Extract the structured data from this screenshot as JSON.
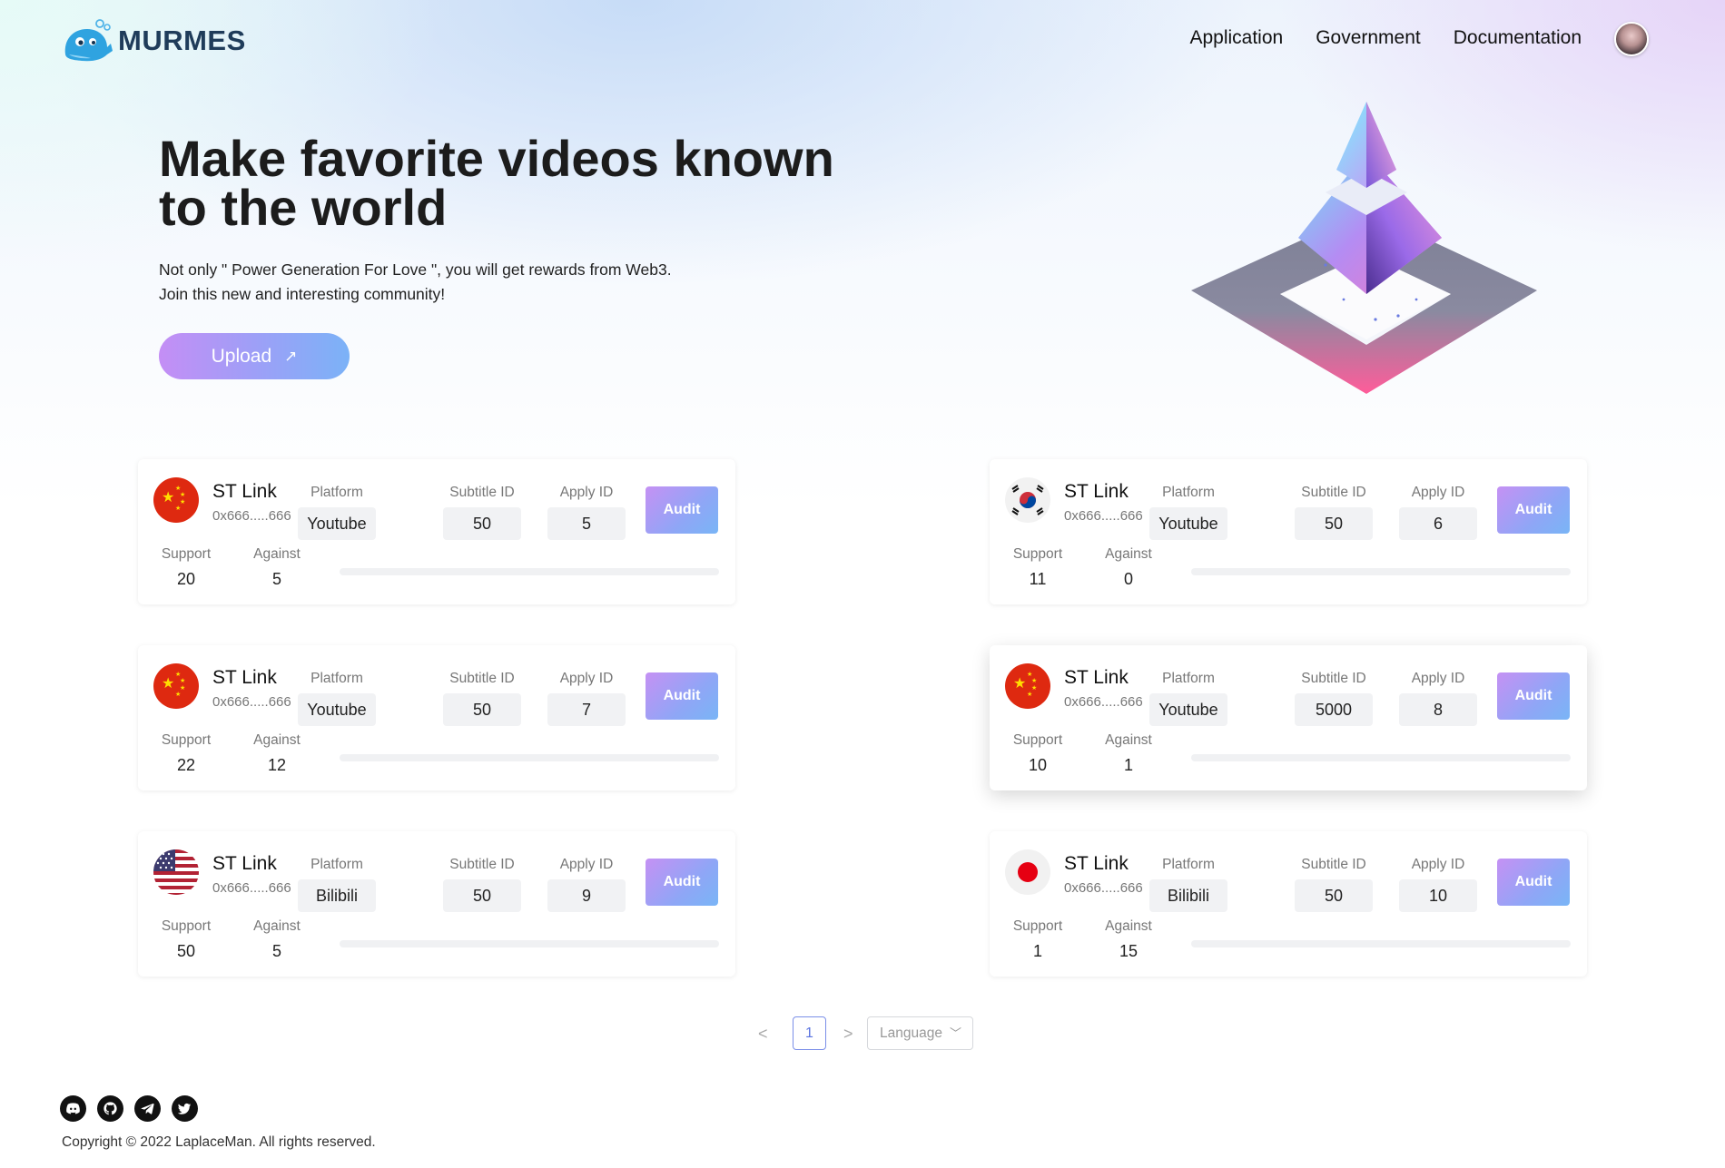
{
  "brand": {
    "name": "MURMES"
  },
  "nav": {
    "items": [
      "Application",
      "Government",
      "Documentation"
    ]
  },
  "hero": {
    "title": "Make favorite videos known to the world",
    "subtitle_line1": "Not only \" Power Generation For Love \", you will get rewards from Web3.",
    "subtitle_line2": "Join this new and interesting community!",
    "upload_label": "Upload",
    "upload_icon": "arrow-up-right-icon"
  },
  "cards": [
    {
      "flag": "china",
      "title": "ST Link",
      "address": "0x666.....666",
      "platform_label": "Platform",
      "platform": "Youtube",
      "subtitle_label": "Subtitle ID",
      "subtitle_id": "50",
      "apply_label": "Apply ID",
      "apply_id": "5",
      "audit_label": "Audit",
      "support_label": "Support",
      "support": "20",
      "against_label": "Against",
      "against": "5"
    },
    {
      "flag": "korea",
      "title": "ST Link",
      "address": "0x666.....666",
      "platform_label": "Platform",
      "platform": "Youtube",
      "subtitle_label": "Subtitle ID",
      "subtitle_id": "50",
      "apply_label": "Apply ID",
      "apply_id": "6",
      "audit_label": "Audit",
      "support_label": "Support",
      "support": "11",
      "against_label": "Against",
      "against": "0"
    },
    {
      "flag": "china",
      "title": "ST Link",
      "address": "0x666.....666",
      "platform_label": "Platform",
      "platform": "Youtube",
      "subtitle_label": "Subtitle ID",
      "subtitle_id": "50",
      "apply_label": "Apply ID",
      "apply_id": "7",
      "audit_label": "Audit",
      "support_label": "Support",
      "support": "22",
      "against_label": "Against",
      "against": "12"
    },
    {
      "flag": "china",
      "title": "ST Link",
      "address": "0x666.....666",
      "platform_label": "Platform",
      "platform": "Youtube",
      "subtitle_label": "Subtitle ID",
      "subtitle_id": "5000",
      "apply_label": "Apply ID",
      "apply_id": "8",
      "audit_label": "Audit",
      "support_label": "Support",
      "support": "10",
      "against_label": "Against",
      "against": "1"
    },
    {
      "flag": "usa",
      "title": "ST Link",
      "address": "0x666.....666",
      "platform_label": "Platform",
      "platform": "Bilibili",
      "subtitle_label": "Subtitle ID",
      "subtitle_id": "50",
      "apply_label": "Apply ID",
      "apply_id": "9",
      "audit_label": "Audit",
      "support_label": "Support",
      "support": "50",
      "against_label": "Against",
      "against": "5"
    },
    {
      "flag": "japan",
      "title": "ST Link",
      "address": "0x666.....666",
      "platform_label": "Platform",
      "platform": "Bilibili",
      "subtitle_label": "Subtitle ID",
      "subtitle_id": "50",
      "apply_label": "Apply ID",
      "apply_id": "10",
      "audit_label": "Audit",
      "support_label": "Support",
      "support": "1",
      "against_label": "Against",
      "against": "15"
    }
  ],
  "pagination": {
    "prev": "<",
    "current": "1",
    "next": ">"
  },
  "language_select": {
    "placeholder": "Language"
  },
  "footer": {
    "socials": [
      "discord-icon",
      "github-icon",
      "telegram-icon",
      "twitter-icon"
    ],
    "copyright": "Copyright © 2022 LaplaceMan. All rights reserved."
  },
  "colors": {
    "accent_start": "#c591f4",
    "accent_end": "#79b5f6",
    "pager_active": "#5b74e0"
  }
}
